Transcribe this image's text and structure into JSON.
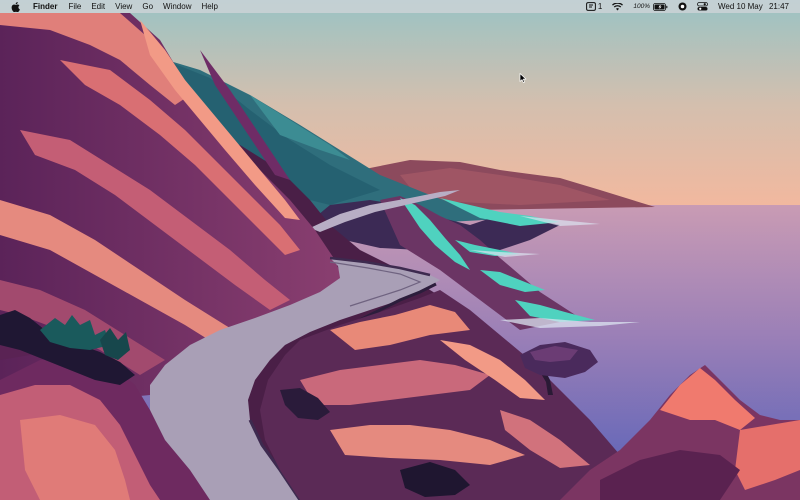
{
  "menubar": {
    "app_name": "Finder",
    "menus": [
      "File",
      "Edit",
      "View",
      "Go",
      "Window",
      "Help"
    ],
    "status": {
      "stage_manager_count": "1",
      "wifi_icon": "wifi-icon",
      "battery_percent": "100%",
      "focus_icon": "focus-icon",
      "control_center_icon": "control-center-icon"
    },
    "clock": {
      "date": "Wed 10 May",
      "time": "21:47"
    }
  },
  "colors": {
    "sky_top": "#9fc4c4",
    "sky_bottom": "#f0b79c",
    "sea_top": "#c99ab8",
    "sea_bottom": "#5b63b8",
    "cliff_pink": "#e8867a",
    "cliff_purple": "#7a3c73",
    "cliff_dark": "#3f1a3d",
    "teal": "#52d3c1",
    "road": "#a59bb3"
  }
}
